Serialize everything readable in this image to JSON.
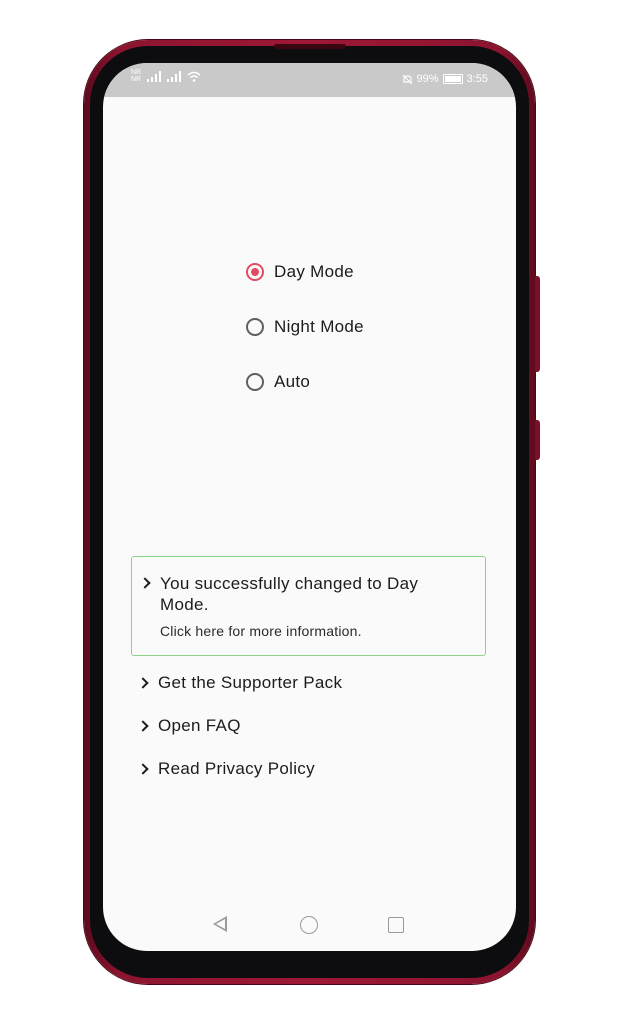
{
  "status_bar": {
    "sim1_label": "NR",
    "sim2_label": "NR",
    "battery_percent": "99%",
    "time": "3:55",
    "icons": [
      "signal-icon",
      "signal-icon",
      "wifi-icon",
      "mute-icon",
      "battery-icon"
    ]
  },
  "theme_options": [
    {
      "label": "Day Mode",
      "checked": true
    },
    {
      "label": "Night Mode",
      "checked": false
    },
    {
      "label": "Auto",
      "checked": false
    }
  ],
  "notice": {
    "title": "You successfully changed to Day Mode.",
    "subtitle": "Click here for more information."
  },
  "links": [
    {
      "label": "Get the Supporter Pack"
    },
    {
      "label": "Open FAQ"
    },
    {
      "label": "Read Privacy Policy"
    }
  ],
  "colors": {
    "accent": "#e04d62",
    "notice_border": "#8fd38a",
    "phone_frame": "#9d1836"
  }
}
